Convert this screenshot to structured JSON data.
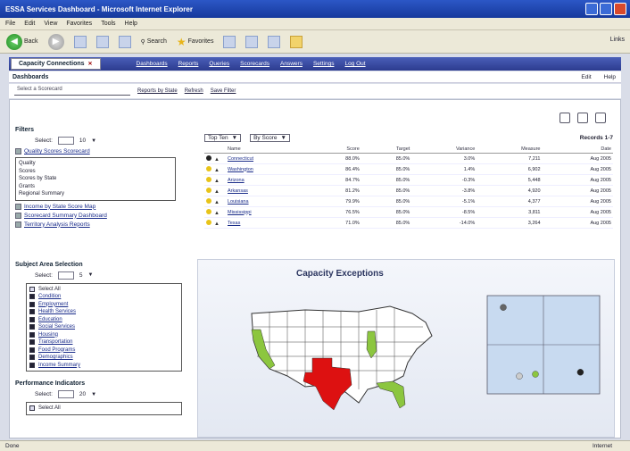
{
  "window": {
    "title": "ESSA Services Dashboard - Microsoft Internet Explorer"
  },
  "menu": [
    "File",
    "Edit",
    "View",
    "Favorites",
    "Tools",
    "Help"
  ],
  "toolbar": {
    "back": "Back",
    "search": "Search",
    "favorites": "Favorites",
    "links": "Links"
  },
  "app": {
    "tab_label": "Capacity Connections",
    "nav_links": [
      "Dashboards",
      "Reports",
      "Queries",
      "Scorecards",
      "Answers",
      "Settings",
      "Log Out"
    ]
  },
  "crumbs": {
    "label": "Dashboards",
    "links": [
      "Edit",
      "Help"
    ]
  },
  "filterbar": {
    "field": "Select a Scorecard",
    "link1": "Reports by State",
    "btn": "Refresh",
    "link2": "Save Filter"
  },
  "sidebar": {
    "section1_title": "Filters",
    "select1": {
      "label": "Select:",
      "value": "10"
    },
    "top_link": "Quality Scores Scorecard",
    "box_items": [
      "Quality",
      "Scores",
      "Scores by State",
      "Grants",
      "Regional Summary"
    ],
    "links": [
      "Income by State Score Map",
      "Scorecard Summary Dashboard",
      "Territory Analysis Reports"
    ],
    "section2_title": "Subject Area Selection",
    "select2": {
      "label": "Select:",
      "value": "5"
    },
    "list_header": "Select All",
    "list_items": [
      "Condition",
      "Employment",
      "Health Services",
      "Education",
      "Social Services",
      "Housing",
      "Transportation",
      "Food Programs",
      "Demographics",
      "Income Summary"
    ],
    "section3_title": "Performance Indicators",
    "select3": {
      "label": "Select:",
      "value": "20"
    },
    "list3_header": "Select All"
  },
  "table": {
    "controls": {
      "dd1": "Top Ten",
      "dd2": "By Score",
      "paging": "Records 1-7"
    },
    "headers": [
      "",
      "Name",
      "Score",
      "Target",
      "Variance",
      "Measure",
      "Date"
    ],
    "rows": [
      {
        "name": "Connecticut",
        "score": "88.0%",
        "target": "85.0%",
        "variance": "3.0%",
        "measure": "7,211",
        "date": "Aug 2005",
        "flag": "#222"
      },
      {
        "name": "Washington",
        "score": "86.4%",
        "target": "85.0%",
        "variance": "1.4%",
        "measure": "6,902",
        "date": "Aug 2005",
        "flag": "#e8c41a"
      },
      {
        "name": "Arizona",
        "score": "84.7%",
        "target": "85.0%",
        "variance": "-0.3%",
        "measure": "5,448",
        "date": "Aug 2005",
        "flag": "#e8c41a"
      },
      {
        "name": "Arkansas",
        "score": "81.2%",
        "target": "85.0%",
        "variance": "-3.8%",
        "measure": "4,920",
        "date": "Aug 2005",
        "flag": "#e8c41a"
      },
      {
        "name": "Louisiana",
        "score": "79.9%",
        "target": "85.0%",
        "variance": "-5.1%",
        "measure": "4,377",
        "date": "Aug 2005",
        "flag": "#e8c41a"
      },
      {
        "name": "Mississippi",
        "score": "76.5%",
        "target": "85.0%",
        "variance": "-8.5%",
        "measure": "3,811",
        "date": "Aug 2005",
        "flag": "#e8c41a"
      },
      {
        "name": "Texas",
        "score": "71.0%",
        "target": "85.0%",
        "variance": "-14.0%",
        "measure": "3,264",
        "date": "Aug 2005",
        "flag": "#e8c41a"
      }
    ]
  },
  "dashboard": {
    "title": "Capacity Exceptions",
    "map_colors": {
      "base": "#ffffff",
      "green": "#8cc63f",
      "red": "#dd1111"
    }
  },
  "chart_data": {
    "type": "scatter",
    "title": "",
    "xlabel": "",
    "ylabel": "",
    "xlim": [
      0,
      7
    ],
    "ylim": [
      0,
      100
    ],
    "points": [
      {
        "x": 1.0,
        "y": 88,
        "color": "#666666"
      },
      {
        "x": 3.0,
        "y": 20,
        "color": "#8cc63f"
      },
      {
        "x": 5.8,
        "y": 22,
        "color": "#222222"
      },
      {
        "x": 2.0,
        "y": 18,
        "color": "#cccccc"
      }
    ],
    "quadrants": {
      "x_split": 3.5,
      "y_split": 50
    }
  },
  "status": {
    "left": "Done",
    "zone": "Internet"
  }
}
